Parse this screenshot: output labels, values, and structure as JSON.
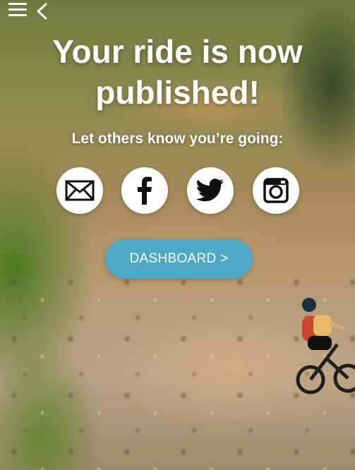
{
  "header": {
    "menu_icon": "hamburger-menu-icon",
    "back_icon": "chevron-left-icon"
  },
  "headline": {
    "line1": "Your ride is now",
    "line2": "published!"
  },
  "share": {
    "prompt": "Let others know you’re going:",
    "buttons": [
      {
        "name": "email",
        "icon": "envelope-icon"
      },
      {
        "name": "facebook",
        "icon": "facebook-icon"
      },
      {
        "name": "twitter",
        "icon": "twitter-bird-icon"
      },
      {
        "name": "instagram",
        "icon": "instagram-icon"
      }
    ]
  },
  "dashboard_button": {
    "label": "DASHBOARD >",
    "color": "#4fa9c4"
  }
}
